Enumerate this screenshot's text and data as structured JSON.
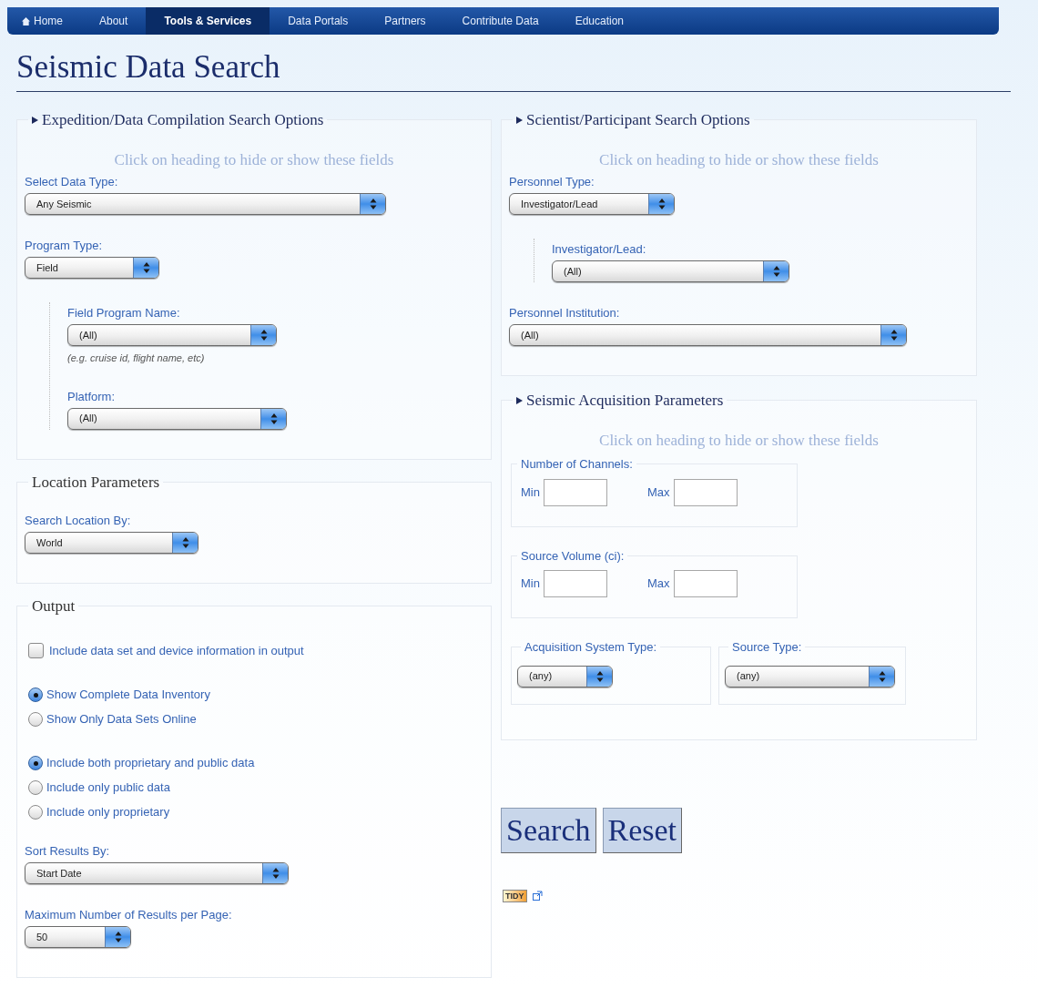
{
  "nav": [
    {
      "kind": "home",
      "label": "Home",
      "selected": false
    },
    {
      "kind": "link",
      "label": "About",
      "selected": false
    },
    {
      "kind": "link",
      "label": "Tools & Services",
      "selected": true
    },
    {
      "kind": "link",
      "label": "Data Portals",
      "selected": false
    },
    {
      "kind": "link",
      "label": "Partners",
      "selected": false
    },
    {
      "kind": "link",
      "label": "Contribute Data",
      "selected": false
    },
    {
      "kind": "link",
      "label": "Education",
      "selected": false
    }
  ],
  "title": "Seismic Data Search",
  "columns": [
    [
      {
        "legend": "Expedition/Data Compilation Search Options",
        "collapsible": true,
        "hint": "Click on heading to hide or show these fields",
        "fields": [
          {
            "kind": "select",
            "label": "Select Data Type:",
            "value": "Any Seismic"
          },
          {
            "kind": "select",
            "label": "Program Type:",
            "value": "Field"
          },
          {
            "kind": "group",
            "fields": [
              {
                "kind": "select",
                "label": "Field Program Name:",
                "value": "(All)",
                "note": "(e.g. cruise id, flight name, etc)"
              },
              {
                "kind": "select",
                "label": "Platform:",
                "value": "(All)"
              }
            ]
          }
        ]
      },
      {
        "legend": "Location Parameters",
        "collapsible": false,
        "fields": [
          {
            "kind": "select",
            "label": "Search Location By:",
            "value": "World"
          }
        ]
      },
      {
        "legend": "Output",
        "collapsible": false,
        "fields": [
          {
            "kind": "checkbox",
            "label": "Include data set and device information in output",
            "checked": false
          },
          {
            "kind": "radios",
            "options": [
              {
                "label": "Show Complete Data Inventory",
                "selected": true
              },
              {
                "label": "Show Only Data Sets Online",
                "selected": false
              }
            ]
          },
          {
            "kind": "radios",
            "options": [
              {
                "label": "Include both proprietary and public data",
                "selected": true
              },
              {
                "label": "Include only public data",
                "selected": false
              },
              {
                "label": "Include only proprietary",
                "selected": false
              }
            ]
          },
          {
            "kind": "select",
            "label": "Sort Results By:",
            "value": "Start Date"
          },
          {
            "kind": "select",
            "label": "Maximum Number of Results per Page:",
            "value": "50"
          }
        ]
      }
    ],
    [
      {
        "legend": "Scientist/Participant Search Options",
        "collapsible": true,
        "hint": "Click on heading to hide or show these fields",
        "fields": [
          {
            "kind": "select",
            "label": "Personnel Type:",
            "value": "Investigator/Lead"
          },
          {
            "kind": "group",
            "fields": [
              {
                "kind": "select",
                "label": "Investigator/Lead:",
                "value": "(All)"
              }
            ]
          },
          {
            "kind": "select",
            "label": "Personnel Institution:",
            "value": "(All)"
          }
        ]
      },
      {
        "legend": "Seismic Acquisition Parameters",
        "collapsible": true,
        "hint": "Click on heading to hide or show these fields",
        "fields": [
          {
            "kind": "range",
            "legend": "Number of Channels:",
            "min_label": "Min",
            "max_label": "Max"
          },
          {
            "kind": "range",
            "legend": "Source Volume (ci):",
            "min_label": "Min",
            "max_label": "Max"
          },
          {
            "kind": "boxed_selects",
            "items": [
              {
                "legend": "Acquisition System Type:",
                "value": "(any)"
              },
              {
                "legend": "Source Type:",
                "value": "(any)"
              }
            ]
          }
        ]
      }
    ]
  ],
  "buttons": [
    "Search",
    "Reset"
  ],
  "badge": {
    "text": "TIDY"
  }
}
